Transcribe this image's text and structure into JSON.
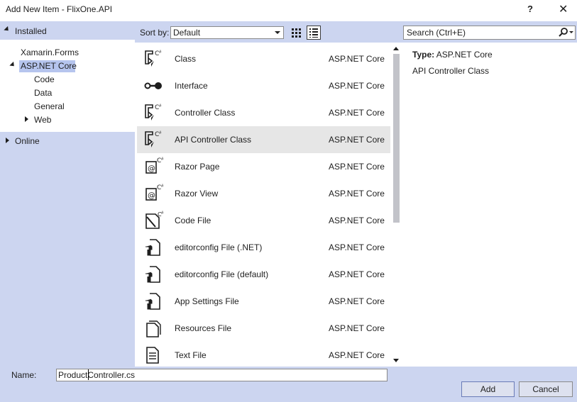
{
  "window": {
    "title": "Add New Item - FlixOne.API",
    "help_label": "?",
    "close_label": "✕"
  },
  "sidebar": {
    "installed_label": "Installed",
    "items": [
      {
        "label": "Xamarin.Forms"
      },
      {
        "label": "ASP.NET Core"
      },
      {
        "label": "Code"
      },
      {
        "label": "Data"
      },
      {
        "label": "General"
      },
      {
        "label": "Web"
      }
    ],
    "online_label": "Online"
  },
  "toolbar": {
    "sort_label": "Sort by:",
    "sort_value": "Default",
    "search_placeholder": "Search (Ctrl+E)"
  },
  "templates": [
    {
      "name": "Class",
      "category": "ASP.NET Core",
      "icon": "csharp-class-icon"
    },
    {
      "name": "Interface",
      "category": "ASP.NET Core",
      "icon": "interface-icon"
    },
    {
      "name": "Controller Class",
      "category": "ASP.NET Core",
      "icon": "csharp-class-icon"
    },
    {
      "name": "API Controller Class",
      "category": "ASP.NET Core",
      "icon": "csharp-class-icon",
      "selected": true
    },
    {
      "name": "Razor Page",
      "category": "ASP.NET Core",
      "icon": "razor-icon"
    },
    {
      "name": "Razor View",
      "category": "ASP.NET Core",
      "icon": "razor-icon"
    },
    {
      "name": "Code File",
      "category": "ASP.NET Core",
      "icon": "code-file-icon"
    },
    {
      "name": "editorconfig File (.NET)",
      "category": "ASP.NET Core",
      "icon": "config-file-icon"
    },
    {
      "name": "editorconfig File (default)",
      "category": "ASP.NET Core",
      "icon": "config-file-icon"
    },
    {
      "name": "App Settings File",
      "category": "ASP.NET Core",
      "icon": "config-file-icon"
    },
    {
      "name": "Resources File",
      "category": "ASP.NET Core",
      "icon": "resources-file-icon"
    },
    {
      "name": "Text File",
      "category": "ASP.NET Core",
      "icon": "text-file-icon"
    }
  ],
  "details": {
    "type_label": "Type:",
    "type_value": "ASP.NET Core",
    "description": "API Controller Class"
  },
  "footer": {
    "name_label": "Name:",
    "name_value": "ProductController.cs",
    "add_label": "Add",
    "cancel_label": "Cancel"
  }
}
